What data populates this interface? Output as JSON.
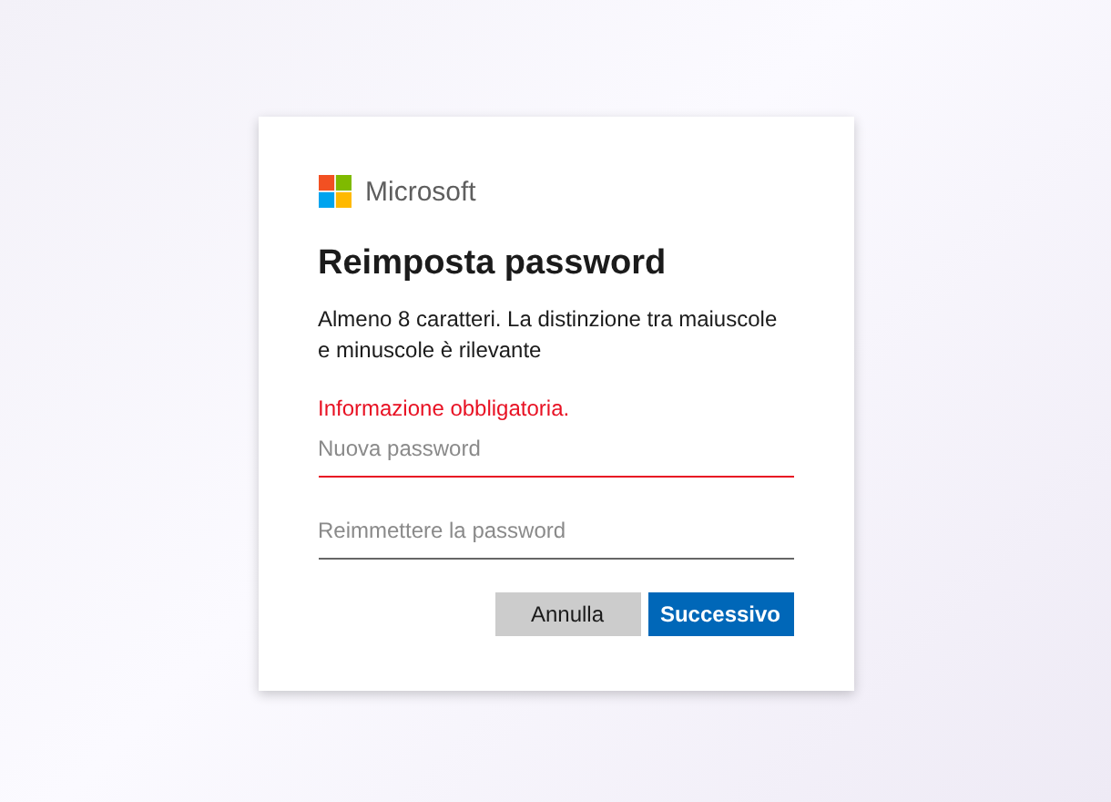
{
  "logo": {
    "text": "Microsoft"
  },
  "title": "Reimposta password",
  "description": "Almeno 8 caratteri. La distinzione tra maiuscole e minuscole è rilevante",
  "error_message": "Informazione obbligatoria.",
  "fields": [
    {
      "placeholder": "Nuova password",
      "error": true
    },
    {
      "placeholder": "Reimmettere la password",
      "error": false
    }
  ],
  "buttons": [
    {
      "label": "Annulla",
      "kind": "secondary"
    },
    {
      "label": "Successivo",
      "kind": "primary"
    }
  ]
}
